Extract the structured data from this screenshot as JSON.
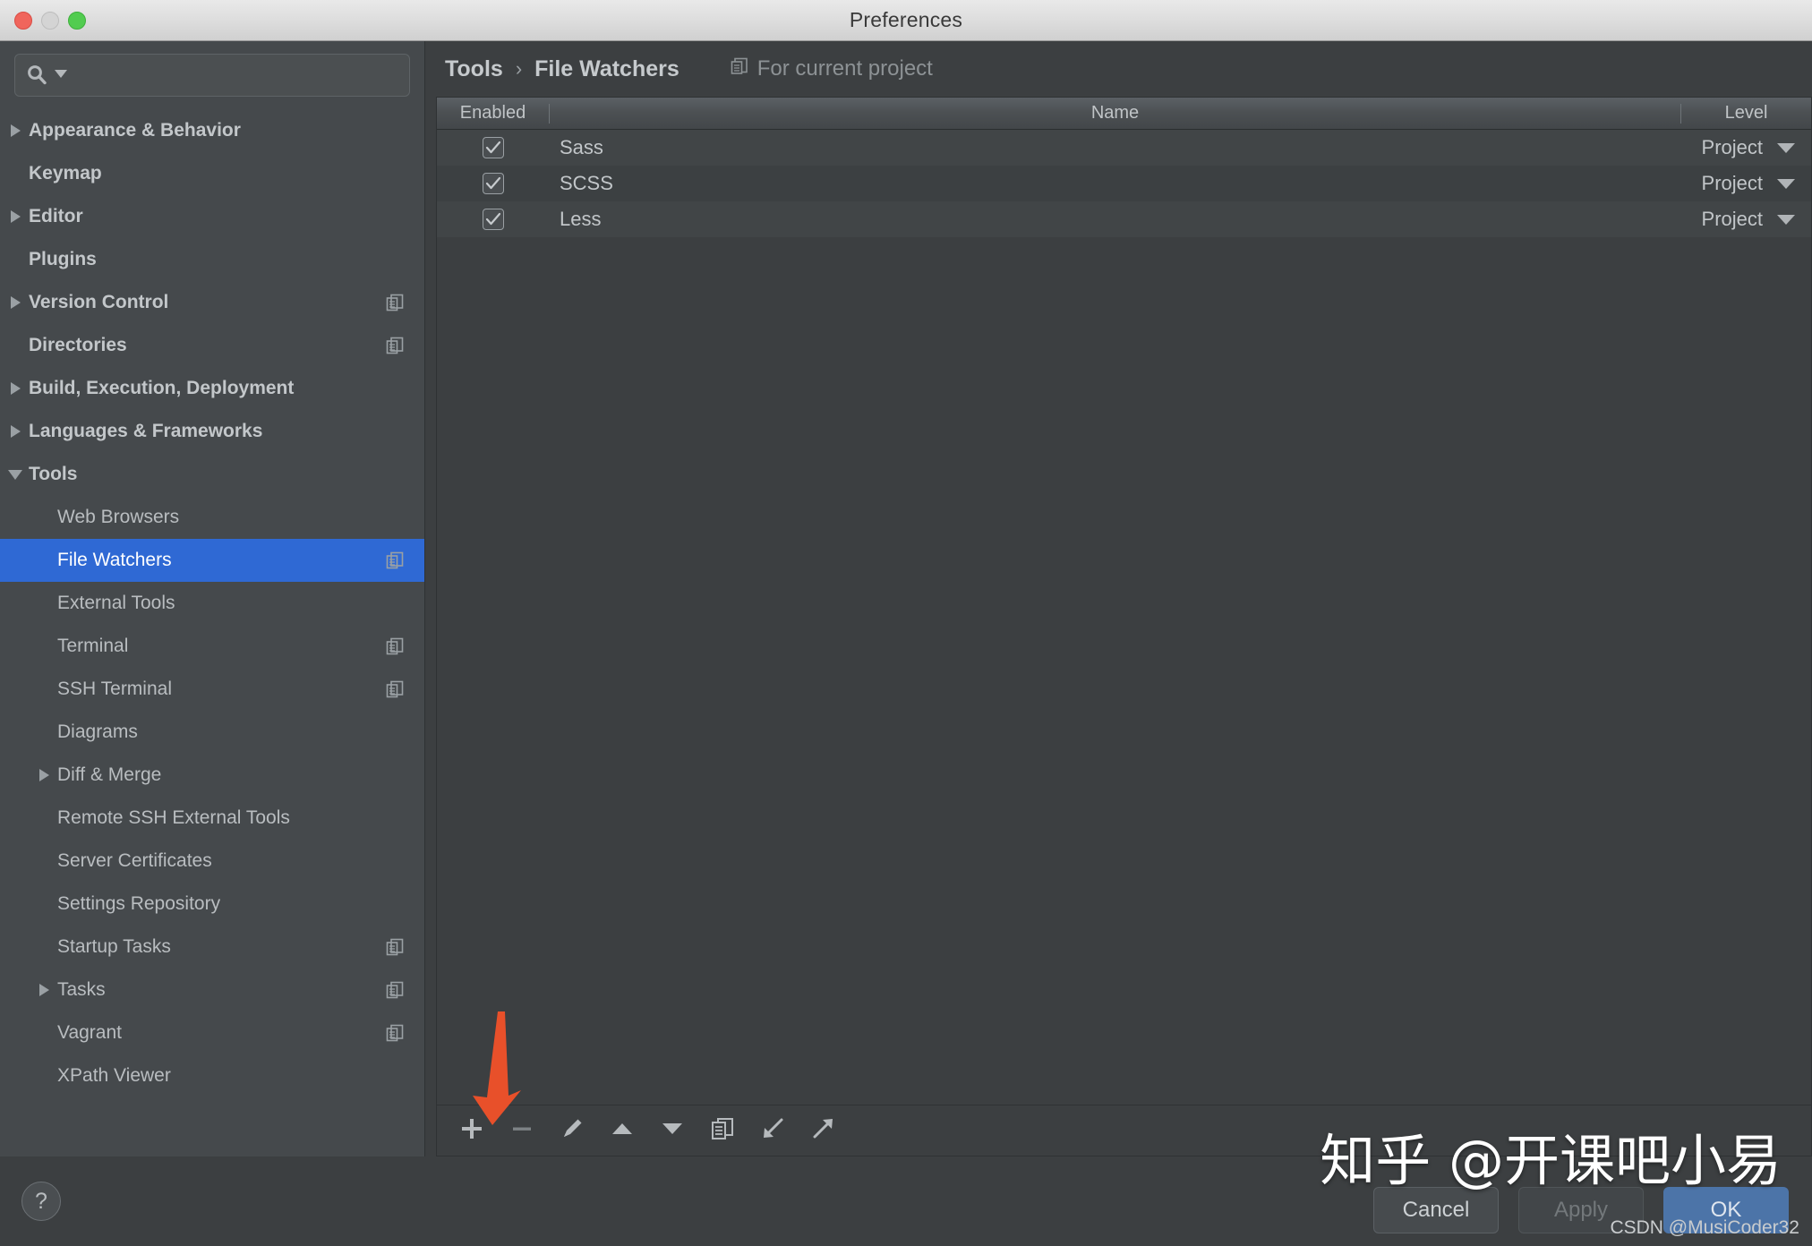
{
  "window": {
    "title": "Preferences",
    "traffic_lights": [
      "close-button",
      "minimize-button",
      "zoom-button"
    ]
  },
  "search": {
    "value": "",
    "placeholder": "",
    "icon": "search-icon",
    "dropdown_icon": "chevron-down-icon"
  },
  "sidebar": {
    "items": [
      {
        "label": "Appearance & Behavior",
        "level": 0,
        "arrow": "collapsed",
        "bold": true,
        "selected": false,
        "scope_icon": false
      },
      {
        "label": "Keymap",
        "level": 0,
        "arrow": "none",
        "bold": true,
        "selected": false,
        "scope_icon": false
      },
      {
        "label": "Editor",
        "level": 0,
        "arrow": "collapsed",
        "bold": true,
        "selected": false,
        "scope_icon": false
      },
      {
        "label": "Plugins",
        "level": 0,
        "arrow": "none",
        "bold": true,
        "selected": false,
        "scope_icon": false
      },
      {
        "label": "Version Control",
        "level": 0,
        "arrow": "collapsed",
        "bold": true,
        "selected": false,
        "scope_icon": true
      },
      {
        "label": "Directories",
        "level": 0,
        "arrow": "none",
        "bold": true,
        "selected": false,
        "scope_icon": true
      },
      {
        "label": "Build, Execution, Deployment",
        "level": 0,
        "arrow": "collapsed",
        "bold": true,
        "selected": false,
        "scope_icon": false
      },
      {
        "label": "Languages & Frameworks",
        "level": 0,
        "arrow": "collapsed",
        "bold": true,
        "selected": false,
        "scope_icon": false
      },
      {
        "label": "Tools",
        "level": 0,
        "arrow": "expanded",
        "bold": true,
        "selected": false,
        "scope_icon": false
      },
      {
        "label": "Web Browsers",
        "level": 1,
        "arrow": "none",
        "bold": false,
        "selected": false,
        "scope_icon": false
      },
      {
        "label": "File Watchers",
        "level": 1,
        "arrow": "none",
        "bold": false,
        "selected": true,
        "scope_icon": true
      },
      {
        "label": "External Tools",
        "level": 1,
        "arrow": "none",
        "bold": false,
        "selected": false,
        "scope_icon": false
      },
      {
        "label": "Terminal",
        "level": 1,
        "arrow": "none",
        "bold": false,
        "selected": false,
        "scope_icon": true
      },
      {
        "label": "SSH Terminal",
        "level": 1,
        "arrow": "none",
        "bold": false,
        "selected": false,
        "scope_icon": true
      },
      {
        "label": "Diagrams",
        "level": 1,
        "arrow": "none",
        "bold": false,
        "selected": false,
        "scope_icon": false
      },
      {
        "label": "Diff & Merge",
        "level": 1,
        "arrow": "collapsed",
        "bold": false,
        "selected": false,
        "scope_icon": false
      },
      {
        "label": "Remote SSH External Tools",
        "level": 1,
        "arrow": "none",
        "bold": false,
        "selected": false,
        "scope_icon": false
      },
      {
        "label": "Server Certificates",
        "level": 1,
        "arrow": "none",
        "bold": false,
        "selected": false,
        "scope_icon": false
      },
      {
        "label": "Settings Repository",
        "level": 1,
        "arrow": "none",
        "bold": false,
        "selected": false,
        "scope_icon": false
      },
      {
        "label": "Startup Tasks",
        "level": 1,
        "arrow": "none",
        "bold": false,
        "selected": false,
        "scope_icon": true
      },
      {
        "label": "Tasks",
        "level": 1,
        "arrow": "collapsed",
        "bold": false,
        "selected": false,
        "scope_icon": true
      },
      {
        "label": "Vagrant",
        "level": 1,
        "arrow": "none",
        "bold": false,
        "selected": false,
        "scope_icon": true
      },
      {
        "label": "XPath Viewer",
        "level": 1,
        "arrow": "none",
        "bold": false,
        "selected": false,
        "scope_icon": false
      }
    ]
  },
  "main": {
    "breadcrumb": {
      "parent": "Tools",
      "separator": "›",
      "current": "File Watchers"
    },
    "scope": {
      "icon": "project-scope-icon",
      "label": "For current project"
    },
    "table": {
      "columns": [
        "Enabled",
        "Name",
        "Level"
      ],
      "rows": [
        {
          "enabled": true,
          "enabled_icon": "checkmark-icon",
          "name": "Sass",
          "level": "Project",
          "level_icon": "chevron-down-icon"
        },
        {
          "enabled": true,
          "enabled_icon": "checkmark-icon",
          "name": "SCSS",
          "level": "Project",
          "level_icon": "chevron-down-icon"
        },
        {
          "enabled": true,
          "enabled_icon": "checkmark-icon",
          "name": "Less",
          "level": "Project",
          "level_icon": "chevron-down-icon"
        }
      ]
    },
    "toolbar": [
      {
        "name": "add-button",
        "icon": "plus-icon",
        "tooltip": "Add"
      },
      {
        "name": "remove-button",
        "icon": "minus-icon",
        "tooltip": "Remove"
      },
      {
        "name": "edit-button",
        "icon": "pencil-icon",
        "tooltip": "Edit"
      },
      {
        "name": "move-up-button",
        "icon": "arrow-up-icon",
        "tooltip": "Move Up"
      },
      {
        "name": "move-down-button",
        "icon": "arrow-down-icon",
        "tooltip": "Move Down"
      },
      {
        "name": "copy-button",
        "icon": "copy-icon",
        "tooltip": "Copy"
      },
      {
        "name": "import-button",
        "icon": "import-arrow-icon",
        "tooltip": "Import"
      },
      {
        "name": "export-button",
        "icon": "export-arrow-icon",
        "tooltip": "Export"
      }
    ]
  },
  "footer": {
    "help_label": "?",
    "buttons": [
      {
        "label": "Cancel",
        "state": "normal"
      },
      {
        "label": "Apply",
        "state": "disabled"
      },
      {
        "label": "OK",
        "state": "primary"
      }
    ]
  },
  "annotations": {
    "arrow_color": "#e8502a",
    "watermark_zhihu": "知乎 @开课吧小易",
    "watermark_csdn": "CSDN @MusiCoder32"
  },
  "colors": {
    "selection": "#2f69d4",
    "window_bg": "#3c3f41",
    "sidebar_bg": "#45494c",
    "primary_button": "#4c74a8"
  }
}
